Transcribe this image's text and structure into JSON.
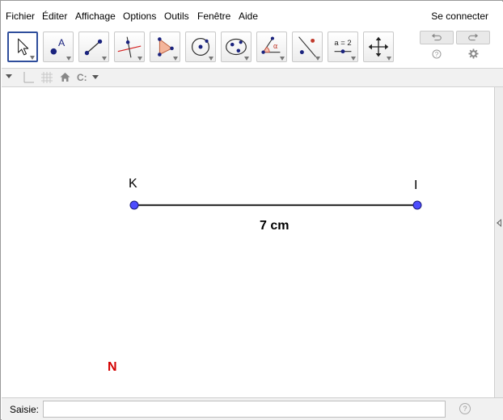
{
  "menu": {
    "items": [
      "Fichier",
      "Éditer",
      "Affichage",
      "Options",
      "Outils",
      "Fenêtre",
      "Aide"
    ],
    "connect_label": "Se connecter"
  },
  "toolbar": {
    "tools": [
      {
        "icon": "move-arrow-icon",
        "active": true
      },
      {
        "icon": "point-icon",
        "active": false
      },
      {
        "icon": "line-icon",
        "active": false
      },
      {
        "icon": "perpendicular-line-icon",
        "active": false
      },
      {
        "icon": "polygon-icon",
        "active": false
      },
      {
        "icon": "circle-icon",
        "active": false
      },
      {
        "icon": "conic-icon",
        "active": false
      },
      {
        "icon": "angle-icon",
        "active": false
      },
      {
        "icon": "reflect-icon",
        "active": false
      },
      {
        "icon": "slider-icon",
        "active": false
      },
      {
        "icon": "move-graphics-view-icon",
        "active": false
      }
    ],
    "slider_tool_text": "a = 2",
    "angle_symbol": "α"
  },
  "stylebar": {
    "label_style": "C:"
  },
  "canvas": {
    "points": [
      {
        "name": "K",
        "color": "#4d4dff"
      },
      {
        "name": "I",
        "color": "#4d4dff"
      }
    ],
    "segment_label": "7 cm",
    "extra_label": "N",
    "extra_label_color": "#d40000",
    "segment_color": "#333333"
  },
  "input": {
    "label": "Saisie:",
    "value": "",
    "placeholder": ""
  },
  "colors": {
    "accent": "#2f4e9c",
    "point": "#4d4dff"
  }
}
